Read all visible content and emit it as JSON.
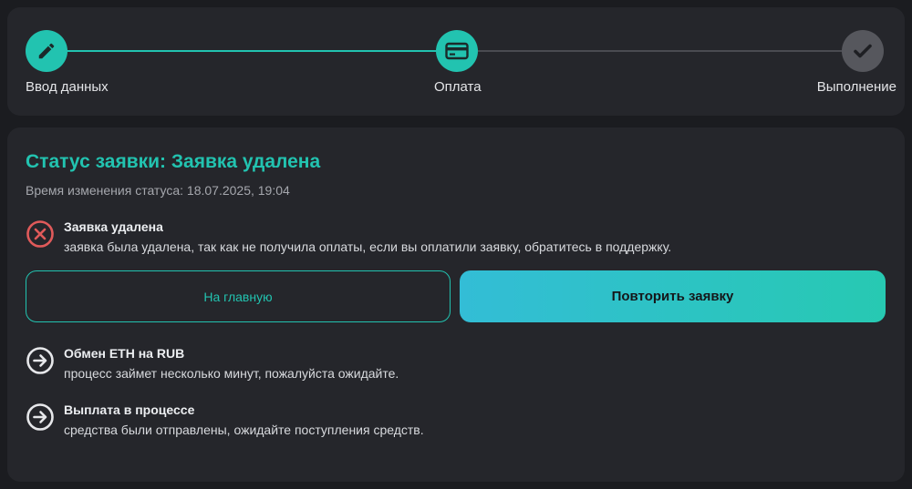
{
  "stepper": {
    "steps": [
      {
        "label": "Ввод данных",
        "icon": "pencil-icon",
        "state": "done"
      },
      {
        "label": "Оплата",
        "icon": "credit-card-icon",
        "state": "current"
      },
      {
        "label": "Выполнение",
        "icon": "checkmark-icon",
        "state": "pending"
      }
    ]
  },
  "status": {
    "title": "Статус заявки: Заявка удалена",
    "time": "Время изменения статуса: 18.07.2025, 19:04",
    "alert": {
      "icon": "error-x-icon",
      "title": "Заявка удалена",
      "description": "заявка была удалена, так как не получила оплаты, если вы оплатили заявку, обратитесь в поддержку."
    },
    "buttons": {
      "home_label": "На главную",
      "retry_label": "Повторить заявку"
    },
    "progress_items": [
      {
        "icon": "arrow-right-circle-icon",
        "title": "Обмен ETH на RUB",
        "description": "процесс займет несколько минут, пожалуйста ожидайте."
      },
      {
        "icon": "arrow-right-circle-icon",
        "title": "Выплата в процессе",
        "description": "средства были отправлены, ожидайте поступления средств."
      }
    ]
  },
  "colors": {
    "accent": "#22c3b0",
    "error": "#e05a5a",
    "background": "#1b1c20",
    "card": "#25262b"
  }
}
